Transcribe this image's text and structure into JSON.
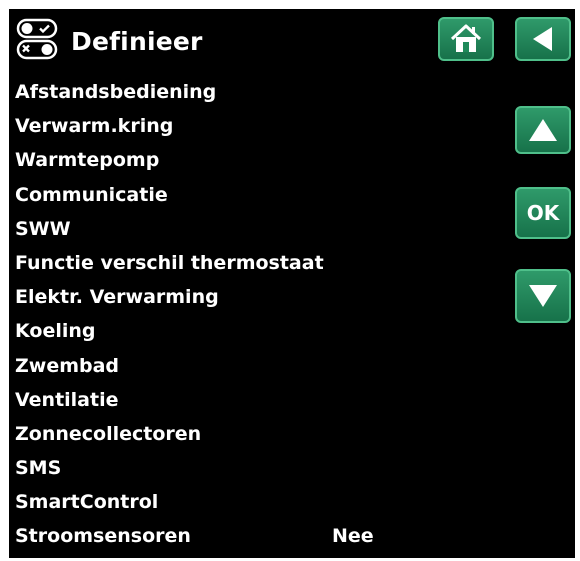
{
  "header": {
    "title": "Definieer",
    "title_icon": "toggle-switches-icon"
  },
  "buttons": {
    "home_icon": "home-icon",
    "back_icon": "back-arrow-icon",
    "up_icon": "up-arrow-icon",
    "ok_label": "OK",
    "down_icon": "down-arrow-icon"
  },
  "menu": {
    "items": [
      {
        "label": "Afstandsbediening",
        "value": ""
      },
      {
        "label": "Verwarm.kring",
        "value": ""
      },
      {
        "label": "Warmtepomp",
        "value": ""
      },
      {
        "label": "Communicatie",
        "value": ""
      },
      {
        "label": "SWW",
        "value": ""
      },
      {
        "label": "Functie verschil thermostaat",
        "value": ""
      },
      {
        "label": "Elektr. Verwarming",
        "value": ""
      },
      {
        "label": "Koeling",
        "value": ""
      },
      {
        "label": "Zwembad",
        "value": ""
      },
      {
        "label": "Ventilatie",
        "value": ""
      },
      {
        "label": "Zonnecollectoren",
        "value": ""
      },
      {
        "label": "SMS",
        "value": ""
      },
      {
        "label": "SmartControl",
        "value": ""
      },
      {
        "label": "Stroomsensoren",
        "value": "Nee"
      }
    ]
  },
  "colors": {
    "background": "#000000",
    "text": "#ffffff",
    "button": "#1f8a5a",
    "button_border": "#4fbf8a"
  }
}
